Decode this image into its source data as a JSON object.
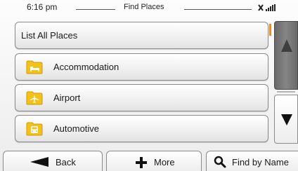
{
  "header": {
    "time": "6:16 pm",
    "title": "Find Places",
    "gps_icon": "gps-signal-icon"
  },
  "list": {
    "items": [
      {
        "label": "List All Places",
        "icon": null
      },
      {
        "label": "Accommodation",
        "icon": "bed-folder-icon"
      },
      {
        "label": "Airport",
        "icon": "airplane-folder-icon"
      },
      {
        "label": "Automotive",
        "icon": "car-folder-icon"
      }
    ],
    "folder_color": "#f2c21b",
    "selection_mark_color": "#f08a1c"
  },
  "scrollbar": {
    "up_icon": "arrow-up-icon",
    "down_icon": "arrow-down-icon"
  },
  "toolbar": {
    "back_label": "Back",
    "more_label": "More",
    "find_label": "Find by Name",
    "back_icon": "back-arrow-icon",
    "more_icon": "plus-icon",
    "find_icon": "magnifier-icon"
  }
}
